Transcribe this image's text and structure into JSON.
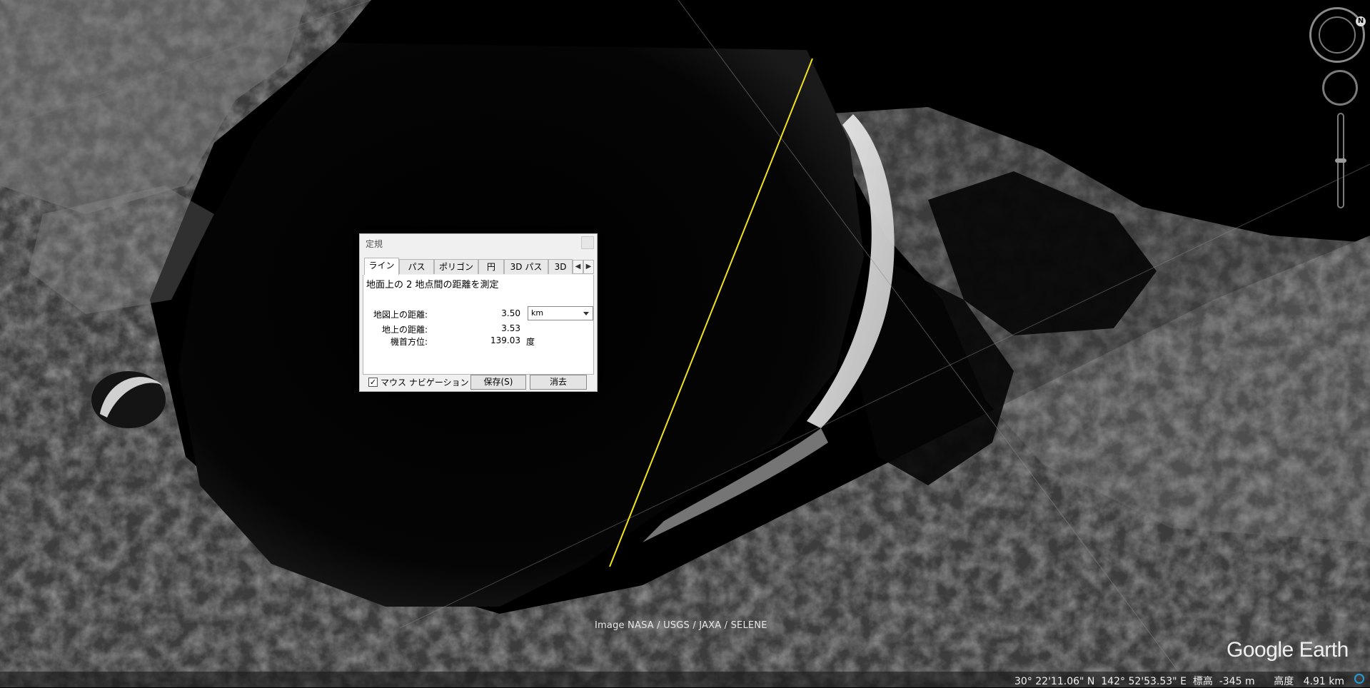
{
  "map": {
    "measure_line_color": "#f2e21a"
  },
  "dialog": {
    "title": "定規",
    "tabs": [
      "ライン",
      "パス",
      "ポリゴン",
      "円",
      "3D パス",
      "3D"
    ],
    "description": "地面上の 2 地点間の距離を測定",
    "map_distance_label": "地図上の距離:",
    "map_distance_value": "3.50",
    "unit": "km",
    "ground_distance_label": "地上の距離:",
    "ground_distance_value": "3.53",
    "heading_label": "機首方位:",
    "heading_value": "139.03",
    "heading_unit": "度",
    "mouse_nav_label": "マウス ナビゲーション",
    "mouse_nav_checked": true,
    "save_label": "保存(S)",
    "clear_label": "消去"
  },
  "attribution": "Image NASA / USGS / JAXA / SELENE",
  "logo": "Google Earth",
  "status": "30° 22'11.06\" N  142° 52'53.53\" E  標高  -345 m      高度   4.91 km"
}
